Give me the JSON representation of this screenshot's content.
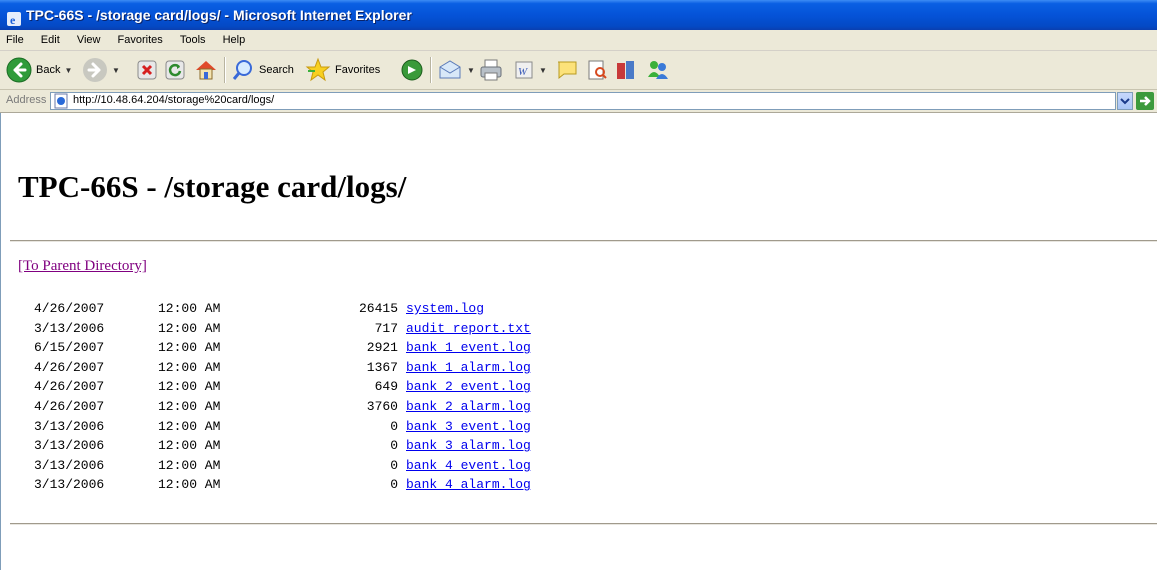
{
  "window": {
    "title": "TPC-66S - /storage card/logs/ - Microsoft Internet Explorer"
  },
  "menu": [
    "File",
    "Edit",
    "View",
    "Favorites",
    "Tools",
    "Help"
  ],
  "toolbar": {
    "back_label": "Back",
    "search_label": "Search",
    "favorites_label": "Favorites"
  },
  "address": {
    "label": "Address",
    "url": "http://10.48.64.204/storage%20card/logs/"
  },
  "page": {
    "heading": "TPC-66S - /storage card/logs/",
    "parent_link": "[To Parent Directory]",
    "files": [
      {
        "date": "4/26/2007",
        "time": "12:00 AM",
        "size": "26415",
        "name": "system.log"
      },
      {
        "date": "3/13/2006",
        "time": "12:00 AM",
        "size": "717",
        "name": "audit_report.txt"
      },
      {
        "date": "6/15/2007",
        "time": "12:00 AM",
        "size": "2921",
        "name": "bank_1_event.log"
      },
      {
        "date": "4/26/2007",
        "time": "12:00 AM",
        "size": "1367",
        "name": "bank_1_alarm.log"
      },
      {
        "date": "4/26/2007",
        "time": "12:00 AM",
        "size": "649",
        "name": "bank_2_event.log"
      },
      {
        "date": "4/26/2007",
        "time": "12:00 AM",
        "size": "3760",
        "name": "bank_2_alarm.log"
      },
      {
        "date": "3/13/2006",
        "time": "12:00 AM",
        "size": "0",
        "name": "bank_3_event.log"
      },
      {
        "date": "3/13/2006",
        "time": "12:00 AM",
        "size": "0",
        "name": "bank_3_alarm.log"
      },
      {
        "date": "3/13/2006",
        "time": "12:00 AM",
        "size": "0",
        "name": "bank_4_event.log"
      },
      {
        "date": "3/13/2006",
        "time": "12:00 AM",
        "size": "0",
        "name": "bank_4_alarm.log"
      }
    ]
  },
  "colors": {
    "link": "#0000ee",
    "visited_link": "#800080",
    "titlebar": "#0553d8"
  },
  "icons": [
    "ie-icon",
    "back-icon",
    "forward-icon",
    "stop-icon",
    "refresh-icon",
    "home-icon",
    "search-icon",
    "favorites-icon",
    "media-icon",
    "mail-icon",
    "print-icon",
    "edit-icon",
    "discuss-icon",
    "research-icon",
    "messenger-icon",
    "page-icon",
    "go-icon"
  ]
}
